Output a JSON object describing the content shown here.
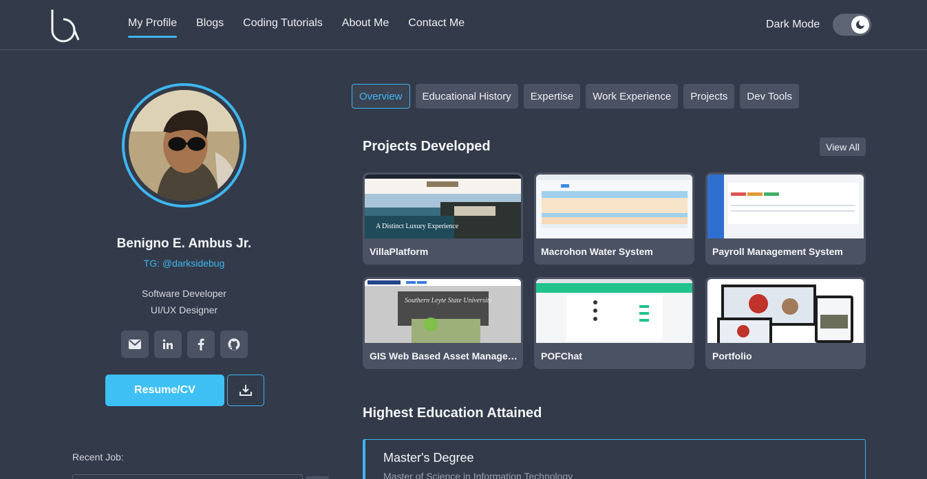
{
  "header": {
    "nav": [
      {
        "label": "My Profile",
        "active": true
      },
      {
        "label": "Blogs"
      },
      {
        "label": "Coding Tutorials"
      },
      {
        "label": "About Me"
      },
      {
        "label": "Contact Me"
      }
    ],
    "dark_mode_label": "Dark Mode",
    "dark_mode_on": true
  },
  "profile": {
    "name": "Benigno E. Ambus Jr.",
    "handle": "TG: @darksidebug",
    "roles": [
      "Software Developer",
      "UI/UX Designer"
    ],
    "socials": [
      "email-icon",
      "linkedin-icon",
      "facebook-icon",
      "github-icon"
    ],
    "resume_label": "Resume/CV",
    "recent_job_label": "Recent Job:"
  },
  "tabs": [
    {
      "label": "Overview",
      "active": true
    },
    {
      "label": "Educational History"
    },
    {
      "label": "Expertise"
    },
    {
      "label": "Work Experience"
    },
    {
      "label": "Projects"
    },
    {
      "label": "Dev Tools"
    }
  ],
  "projects": {
    "title": "Projects Developed",
    "view_all": "View All",
    "items": [
      {
        "title": "VillaPlatform",
        "thumb_caption": "A Distinct Luxury Experience"
      },
      {
        "title": "Macrohon Water System"
      },
      {
        "title": "Payroll Management System"
      },
      {
        "title": "GIS Web Based Asset Management System",
        "thumb_caption": "Southern Leyte State University"
      },
      {
        "title": "POFChat"
      },
      {
        "title": "Portfolio"
      }
    ]
  },
  "education": {
    "title": "Highest Education Attained",
    "degree": "Master's Degree",
    "program": "Master of Science in Information Technology"
  },
  "colors": {
    "background": "#333a49",
    "accent": "#3eb6f0",
    "surface": "#4b5263"
  }
}
